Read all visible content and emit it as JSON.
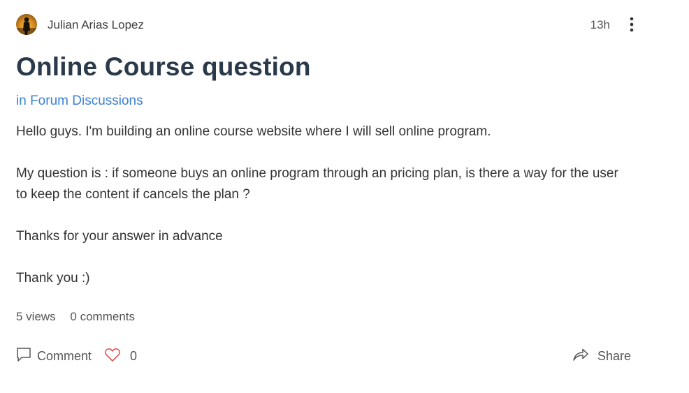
{
  "post": {
    "author": "Julian Arias Lopez",
    "time": "13h",
    "title": "Online Course question",
    "category_prefix": "in",
    "category": "Forum Discussions",
    "paragraphs": [
      "Hello guys. I'm building an online course website where I will sell online program.",
      "My question is : if someone buys an online program through an pricing plan, is there a way for the user to keep the content if cancels the plan ?",
      "Thanks for your answer in advance",
      "Thank you :)"
    ],
    "views": "5 views",
    "comments": "0 comments"
  },
  "actions": {
    "comment_label": "Comment",
    "like_count": "0",
    "share_label": "Share"
  },
  "colors": {
    "title": "#2b3a4a",
    "link": "#3d80d6",
    "heart": "#e5504f"
  },
  "icons": [
    "avatar",
    "more-vertical-icon",
    "comment-icon",
    "heart-icon",
    "share-icon"
  ]
}
